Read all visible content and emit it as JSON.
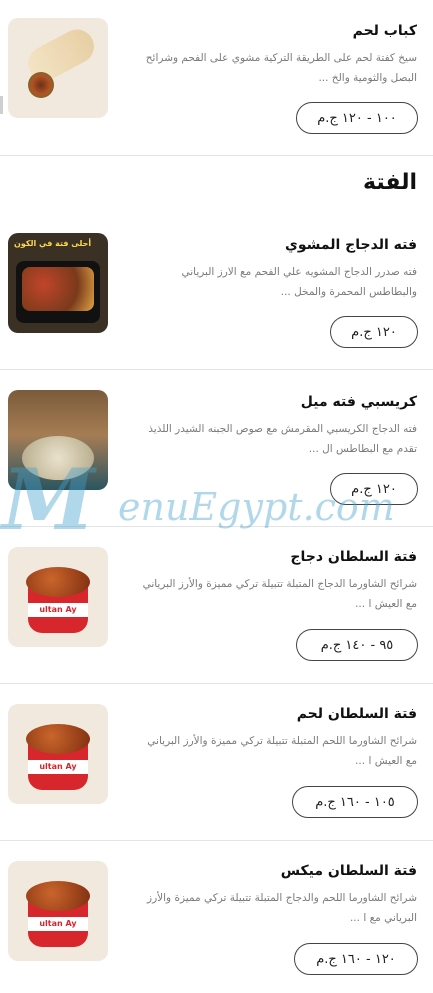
{
  "section": {
    "title": "الفتة"
  },
  "items": [
    {
      "name": "كباب لحم",
      "description": "سيخ كفتة لحم على الطريقة التركية مشوي على الفحم وشرائح البصل والثومية والخ ...",
      "price": "١٠٠ - ١٢٠ ج.م",
      "image": "kebab-wrap-image"
    },
    {
      "name": "فته الدجاج المشوي",
      "description": "فته صدرر الدجاج المشويه علي الفحم مع الارز البرياني والبطاطس المحمرة والمخل ...",
      "price": "١٢٠ ج.م",
      "image": "grilled-chicken-fatteh-image",
      "banner": "أحلى فتة في الكون"
    },
    {
      "name": "كريسبي فته ميل",
      "description": "فته الدجاج الكريسبي المقرمش مع صوص الجبنه الشيدر اللذيذ تقدم مع البطاطس ال ...",
      "price": "١٢٠ ج.م",
      "image": "crispy-fatteh-image"
    },
    {
      "name": "فتة السلطان دجاج",
      "description": "شرائح الشاورما الدجاج المتبلة تتبيلة تركي مميزة والأرز البرياني مع العيش ا ...",
      "price": "٩٥ - ١٤٠ ج.م",
      "image": "sultan-chicken-image",
      "brand": "ultan Ay"
    },
    {
      "name": "فتة السلطان لحم",
      "description": "شرائح الشاورما اللحم المتبلة تتبيلة تركي مميزة والأرز البرياني مع العيش ا ...",
      "price": "١٠٥ - ١٦٠ ج.م",
      "image": "sultan-meat-image",
      "brand": "ultan Ay"
    },
    {
      "name": "فتة السلطان ميكس",
      "description": "شرائح الشاورما اللحم والدجاج المتبلة تتبيلة تركي مميزة والأرز البرياني مع ا ...",
      "price": "١٢٠ - ١٦٠ ج.م",
      "image": "sultan-mix-image",
      "brand": "ultan Ay"
    }
  ],
  "watermark": {
    "big": "M",
    "rest": "enuEgypt.com"
  }
}
